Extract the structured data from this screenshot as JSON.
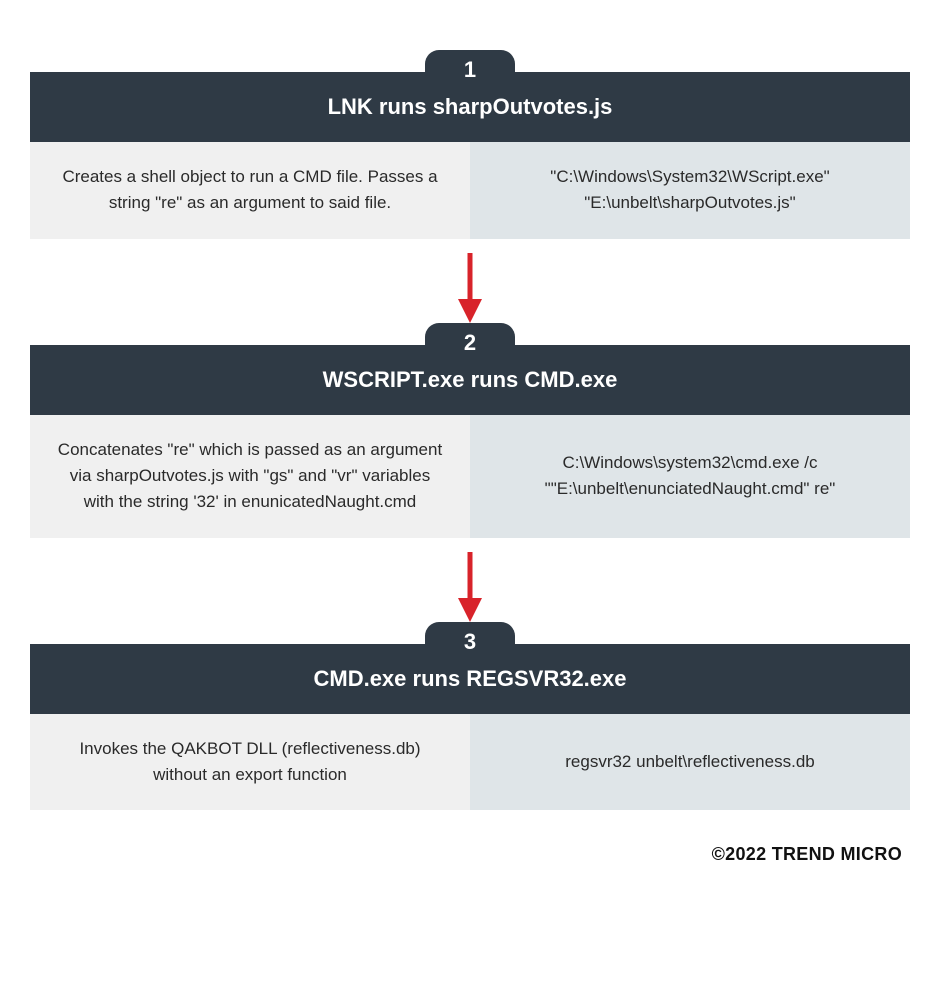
{
  "steps": [
    {
      "number": "1",
      "title": "LNK runs sharpOutvotes.js",
      "left": "Creates a shell object to run a CMD file. Passes a string \"re\" as an argument to said file.",
      "right": "\"C:\\Windows\\System32\\WScript.exe\"\n\"E:\\unbelt\\sharpOutvotes.js\""
    },
    {
      "number": "2",
      "title": "WSCRIPT.exe runs CMD.exe",
      "left": "Concatenates \"re\" which is passed as an argument via sharpOutvotes.js with \"gs\" and \"vr\" variables with the string '32' in enunicatedNaught.cmd",
      "right": "C:\\Windows\\system32\\cmd.exe /c \"\"E:\\unbelt\\enunciatedNaught.cmd\" re\""
    },
    {
      "number": "3",
      "title": "CMD.exe runs REGSVR32.exe",
      "left": "Invokes the QAKBOT DLL (reflectiveness.db) without an export function",
      "right": "regsvr32 unbelt\\reflectiveness.db"
    }
  ],
  "footer": "©2022 TREND MICRO"
}
